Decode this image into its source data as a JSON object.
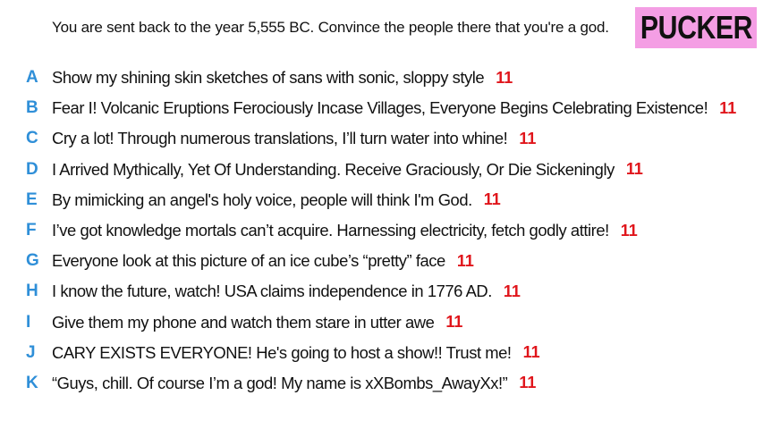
{
  "prompt": "You are sent back to the year 5,555 BC. Convince the people there that you're a god.",
  "logo": "PUCKER",
  "answers": [
    {
      "letter": "A",
      "text": "Show my shining skin sketches of sans with sonic, sloppy style",
      "score": "11"
    },
    {
      "letter": "B",
      "text": "Fear I! Volcanic Eruptions Ferociously Incase Villages, Everyone Begins Celebrating Existence!",
      "score": "11"
    },
    {
      "letter": "C",
      "text": "Cry a lot! Through numerous translations, I’ll turn water into whine!",
      "score": "11"
    },
    {
      "letter": "D",
      "text": "I Arrived Mythically, Yet Of Understanding. Receive Graciously, Or Die Sickeningly",
      "score": "11"
    },
    {
      "letter": "E",
      "text": "By mimicking an angel's holy voice, people will think I'm God.",
      "score": "11"
    },
    {
      "letter": "F",
      "text": "I’ve got knowledge mortals can’t acquire. Harnessing electricity, fetch godly attire!",
      "score": "11"
    },
    {
      "letter": "G",
      "text": "Everyone look at this picture of an ice cube’s “pretty” face",
      "score": "11"
    },
    {
      "letter": "H",
      "text": "I know the future, watch! USA claims independence in 1776 AD.",
      "score": "11"
    },
    {
      "letter": "I",
      "text": "Give them my phone and watch them stare in utter awe",
      "score": "11"
    },
    {
      "letter": "J",
      "text": "CARY EXISTS EVERYONE! He's going to host a show!! Trust me!",
      "score": "11"
    },
    {
      "letter": "K",
      "text": "“Guys, chill. Of course I’m a god! My name is xXBombs_AwayXx!”",
      "score": "11"
    }
  ]
}
